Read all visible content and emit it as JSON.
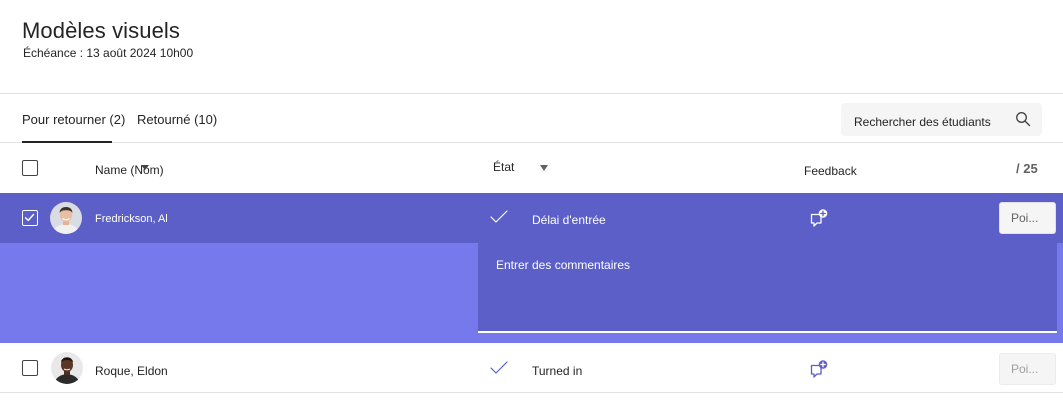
{
  "assignment": {
    "title": "Modèles visuels",
    "due": "Échéance : 13 août 2024 10h00"
  },
  "tabs": [
    {
      "label": "Pour retourner (2)",
      "active": true
    },
    {
      "label": "Retourné (10)",
      "active": false
    }
  ],
  "search": {
    "placeholder": "Rechercher des étudiants",
    "icon": "search-icon"
  },
  "columns": {
    "name": "Name (Nom)",
    "state": "État",
    "feedback": "Feedback",
    "points": "/ 25"
  },
  "students": [
    {
      "name": "Fredrickson, Al",
      "status": "Délai d'entrée",
      "selected": true,
      "points_placeholder": "Poi...",
      "comment_placeholder": "Entrer des commentaires"
    },
    {
      "name": "Roque, Eldon",
      "status": "Turned in",
      "selected": false,
      "points_placeholder": "Poi..."
    }
  ],
  "colors": {
    "accent": "#5b5fc7",
    "accent_light": "#7579eb"
  }
}
